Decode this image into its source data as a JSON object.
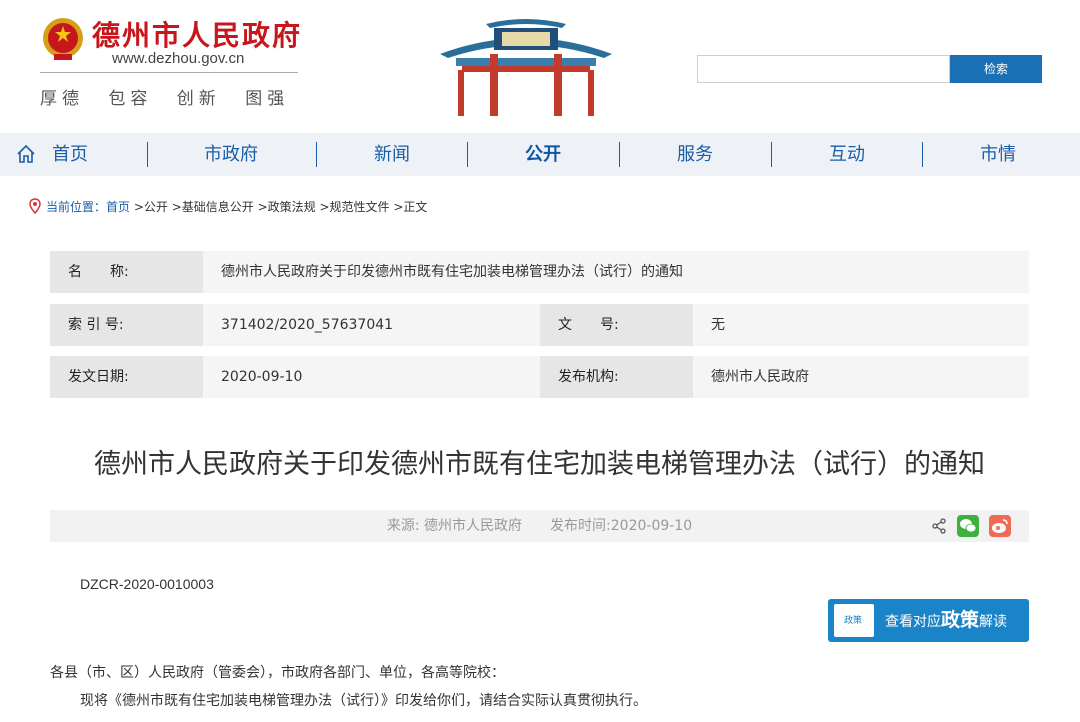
{
  "header": {
    "site_name": "德州市人民政府",
    "site_url": "www.dezhou.gov.cn",
    "slogan": "厚德 包容 创新 图强",
    "search_placeholder": "",
    "search_label": "检索"
  },
  "nav": {
    "items": [
      {
        "label": "首页"
      },
      {
        "label": "市政府"
      },
      {
        "label": "新闻"
      },
      {
        "label": "公开"
      },
      {
        "label": "服务"
      },
      {
        "label": "互动"
      },
      {
        "label": "市情"
      }
    ],
    "active_index": 3
  },
  "breadcrumb": {
    "prefix": "当前位置：",
    "home": "首页",
    "rest": " >公开 >基础信息公开 >政策法规 >规范性文件 >正文"
  },
  "info": {
    "name_label": "名　　称:",
    "name_value": "德州市人民政府关于印发德州市既有住宅加装电梯管理办法（试行）的通知",
    "index_label": "索 引 号:",
    "index_value": "371402/2020_57637041",
    "docno_label": "文　　号:",
    "docno_value": "无",
    "date_label": "发文日期:",
    "date_value": "2020-09-10",
    "org_label": "发布机构:",
    "org_value": "德州市人民政府"
  },
  "article": {
    "title": "德州市人民政府关于印发德州市既有住宅加装电梯管理办法（试行）的通知",
    "meta": "来源: 德州市人民政府　　发布时间:2020-09-10",
    "doc_number": "DZCR-2020-0010003",
    "interp_icon": "政策",
    "interp_prefix": "查看对应",
    "interp_bold": "政策",
    "interp_suffix": "解读",
    "para1": "各县（市、区）人民政府（管委会），市政府各部门、单位，各高等院校：",
    "para2": "现将《德州市既有住宅加装电梯管理办法（试行）》印发给你们，请结合实际认真贯彻执行。"
  },
  "colors": {
    "brand_red": "#c8161d",
    "nav_blue": "#1a5ea8",
    "button_blue": "#1a84c8"
  }
}
